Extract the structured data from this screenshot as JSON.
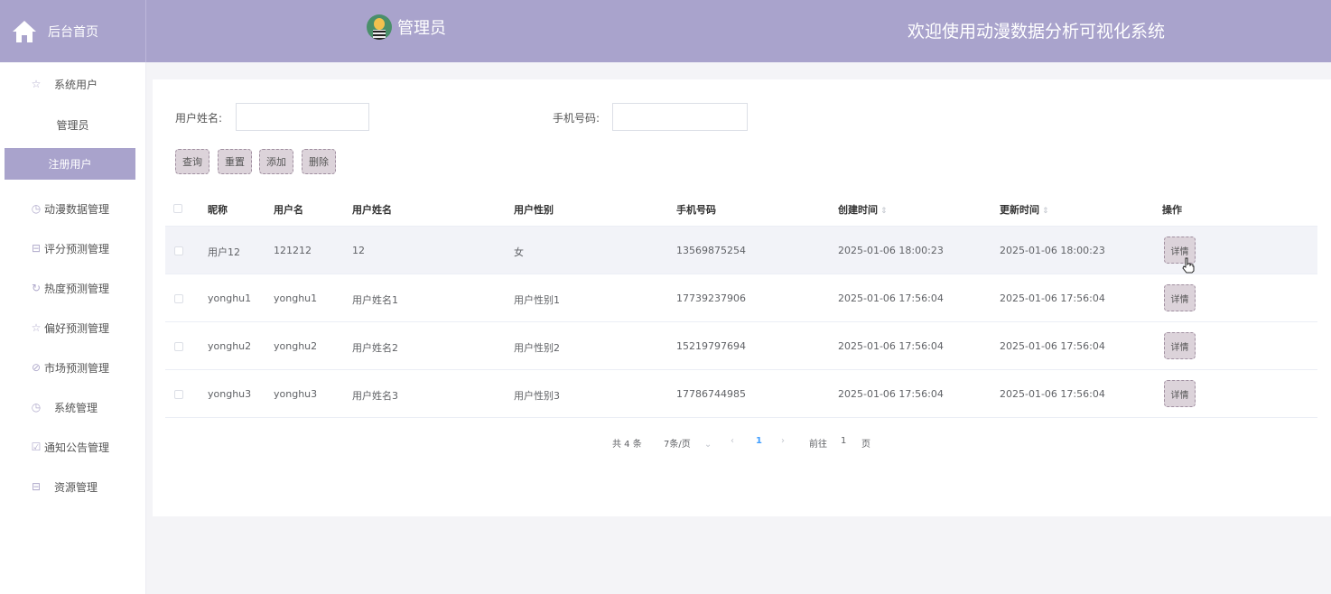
{
  "header": {
    "home_label": "后台首页",
    "admin_label": "管理员",
    "welcome": "欢迎使用动漫数据分析可视化系统"
  },
  "sidebar": {
    "items": [
      {
        "label": "系统用户",
        "icon": "star-icon"
      },
      {
        "label": "管理员"
      },
      {
        "label": "注册用户",
        "active": true
      },
      {
        "label": "动漫数据管理",
        "icon": "clock-icon"
      },
      {
        "label": "评分预测管理",
        "icon": "gift-icon"
      },
      {
        "label": "热度预测管理",
        "icon": "refresh-icon"
      },
      {
        "label": "偏好预测管理",
        "icon": "star-icon"
      },
      {
        "label": "市场预测管理",
        "icon": "compass-icon"
      },
      {
        "label": "系统管理",
        "icon": "clock-icon"
      },
      {
        "label": "通知公告管理",
        "icon": "check-icon"
      },
      {
        "label": "资源管理",
        "icon": "gift-icon"
      }
    ]
  },
  "search": {
    "name_label": "用户姓名:",
    "name_value": "",
    "phone_label": "手机号码:",
    "phone_value": ""
  },
  "actions": {
    "query": "查询",
    "reset": "重置",
    "add": "添加",
    "delete": "删除"
  },
  "table": {
    "columns": [
      "昵称",
      "用户名",
      "用户姓名",
      "用户性别",
      "手机号码",
      "创建时间",
      "更新时间",
      "操作"
    ],
    "detail_label": "详情",
    "rows": [
      {
        "nickname": "用户12",
        "username": "121212",
        "realname": "12",
        "gender": "女",
        "phone": "13569875254",
        "created": "2025-01-06 18:00:23",
        "updated": "2025-01-06 18:00:23"
      },
      {
        "nickname": "yonghu1",
        "username": "yonghu1",
        "realname": "用户姓名1",
        "gender": "用户性别1",
        "phone": "17739237906",
        "created": "2025-01-06 17:56:04",
        "updated": "2025-01-06 17:56:04"
      },
      {
        "nickname": "yonghu2",
        "username": "yonghu2",
        "realname": "用户姓名2",
        "gender": "用户性别2",
        "phone": "15219797694",
        "created": "2025-01-06 17:56:04",
        "updated": "2025-01-06 17:56:04"
      },
      {
        "nickname": "yonghu3",
        "username": "yonghu3",
        "realname": "用户姓名3",
        "gender": "用户性别3",
        "phone": "17786744985",
        "created": "2025-01-06 17:56:04",
        "updated": "2025-01-06 17:56:04"
      }
    ]
  },
  "pagination": {
    "total": "共 4 条",
    "page_size": "7条/页",
    "current_page": "1",
    "goto_prefix": "前往",
    "goto_value": "1",
    "goto_suffix": "页"
  },
  "colors": {
    "accent": "#a9a3cc",
    "button_bg": "#dcd3da",
    "page_link": "#409eff"
  }
}
